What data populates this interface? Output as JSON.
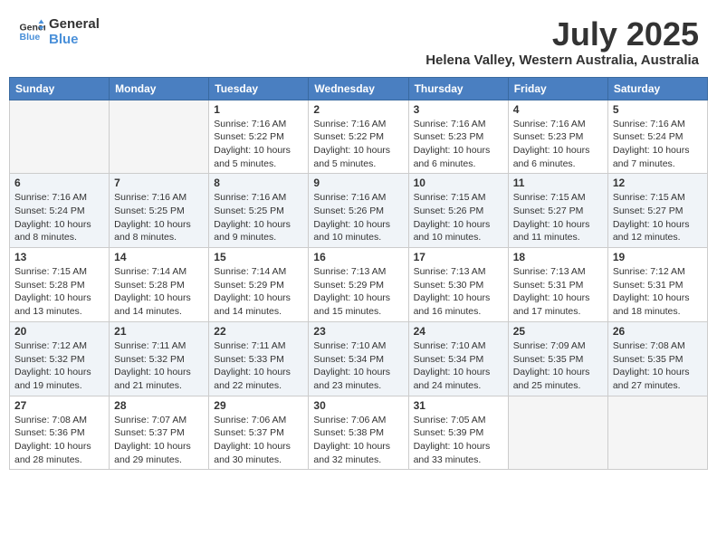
{
  "header": {
    "logo_line1": "General",
    "logo_line2": "Blue",
    "month": "July 2025",
    "location": "Helena Valley, Western Australia, Australia"
  },
  "weekdays": [
    "Sunday",
    "Monday",
    "Tuesday",
    "Wednesday",
    "Thursday",
    "Friday",
    "Saturday"
  ],
  "weeks": [
    [
      {
        "day": "",
        "info": ""
      },
      {
        "day": "",
        "info": ""
      },
      {
        "day": "1",
        "info": "Sunrise: 7:16 AM\nSunset: 5:22 PM\nDaylight: 10 hours and 5 minutes."
      },
      {
        "day": "2",
        "info": "Sunrise: 7:16 AM\nSunset: 5:22 PM\nDaylight: 10 hours and 5 minutes."
      },
      {
        "day": "3",
        "info": "Sunrise: 7:16 AM\nSunset: 5:23 PM\nDaylight: 10 hours and 6 minutes."
      },
      {
        "day": "4",
        "info": "Sunrise: 7:16 AM\nSunset: 5:23 PM\nDaylight: 10 hours and 6 minutes."
      },
      {
        "day": "5",
        "info": "Sunrise: 7:16 AM\nSunset: 5:24 PM\nDaylight: 10 hours and 7 minutes."
      }
    ],
    [
      {
        "day": "6",
        "info": "Sunrise: 7:16 AM\nSunset: 5:24 PM\nDaylight: 10 hours and 8 minutes."
      },
      {
        "day": "7",
        "info": "Sunrise: 7:16 AM\nSunset: 5:25 PM\nDaylight: 10 hours and 8 minutes."
      },
      {
        "day": "8",
        "info": "Sunrise: 7:16 AM\nSunset: 5:25 PM\nDaylight: 10 hours and 9 minutes."
      },
      {
        "day": "9",
        "info": "Sunrise: 7:16 AM\nSunset: 5:26 PM\nDaylight: 10 hours and 10 minutes."
      },
      {
        "day": "10",
        "info": "Sunrise: 7:15 AM\nSunset: 5:26 PM\nDaylight: 10 hours and 10 minutes."
      },
      {
        "day": "11",
        "info": "Sunrise: 7:15 AM\nSunset: 5:27 PM\nDaylight: 10 hours and 11 minutes."
      },
      {
        "day": "12",
        "info": "Sunrise: 7:15 AM\nSunset: 5:27 PM\nDaylight: 10 hours and 12 minutes."
      }
    ],
    [
      {
        "day": "13",
        "info": "Sunrise: 7:15 AM\nSunset: 5:28 PM\nDaylight: 10 hours and 13 minutes."
      },
      {
        "day": "14",
        "info": "Sunrise: 7:14 AM\nSunset: 5:28 PM\nDaylight: 10 hours and 14 minutes."
      },
      {
        "day": "15",
        "info": "Sunrise: 7:14 AM\nSunset: 5:29 PM\nDaylight: 10 hours and 14 minutes."
      },
      {
        "day": "16",
        "info": "Sunrise: 7:13 AM\nSunset: 5:29 PM\nDaylight: 10 hours and 15 minutes."
      },
      {
        "day": "17",
        "info": "Sunrise: 7:13 AM\nSunset: 5:30 PM\nDaylight: 10 hours and 16 minutes."
      },
      {
        "day": "18",
        "info": "Sunrise: 7:13 AM\nSunset: 5:31 PM\nDaylight: 10 hours and 17 minutes."
      },
      {
        "day": "19",
        "info": "Sunrise: 7:12 AM\nSunset: 5:31 PM\nDaylight: 10 hours and 18 minutes."
      }
    ],
    [
      {
        "day": "20",
        "info": "Sunrise: 7:12 AM\nSunset: 5:32 PM\nDaylight: 10 hours and 19 minutes."
      },
      {
        "day": "21",
        "info": "Sunrise: 7:11 AM\nSunset: 5:32 PM\nDaylight: 10 hours and 21 minutes."
      },
      {
        "day": "22",
        "info": "Sunrise: 7:11 AM\nSunset: 5:33 PM\nDaylight: 10 hours and 22 minutes."
      },
      {
        "day": "23",
        "info": "Sunrise: 7:10 AM\nSunset: 5:34 PM\nDaylight: 10 hours and 23 minutes."
      },
      {
        "day": "24",
        "info": "Sunrise: 7:10 AM\nSunset: 5:34 PM\nDaylight: 10 hours and 24 minutes."
      },
      {
        "day": "25",
        "info": "Sunrise: 7:09 AM\nSunset: 5:35 PM\nDaylight: 10 hours and 25 minutes."
      },
      {
        "day": "26",
        "info": "Sunrise: 7:08 AM\nSunset: 5:35 PM\nDaylight: 10 hours and 27 minutes."
      }
    ],
    [
      {
        "day": "27",
        "info": "Sunrise: 7:08 AM\nSunset: 5:36 PM\nDaylight: 10 hours and 28 minutes."
      },
      {
        "day": "28",
        "info": "Sunrise: 7:07 AM\nSunset: 5:37 PM\nDaylight: 10 hours and 29 minutes."
      },
      {
        "day": "29",
        "info": "Sunrise: 7:06 AM\nSunset: 5:37 PM\nDaylight: 10 hours and 30 minutes."
      },
      {
        "day": "30",
        "info": "Sunrise: 7:06 AM\nSunset: 5:38 PM\nDaylight: 10 hours and 32 minutes."
      },
      {
        "day": "31",
        "info": "Sunrise: 7:05 AM\nSunset: 5:39 PM\nDaylight: 10 hours and 33 minutes."
      },
      {
        "day": "",
        "info": ""
      },
      {
        "day": "",
        "info": ""
      }
    ]
  ],
  "colors": {
    "header_bg": "#4a7fc1",
    "accent": "#4a90d9"
  }
}
